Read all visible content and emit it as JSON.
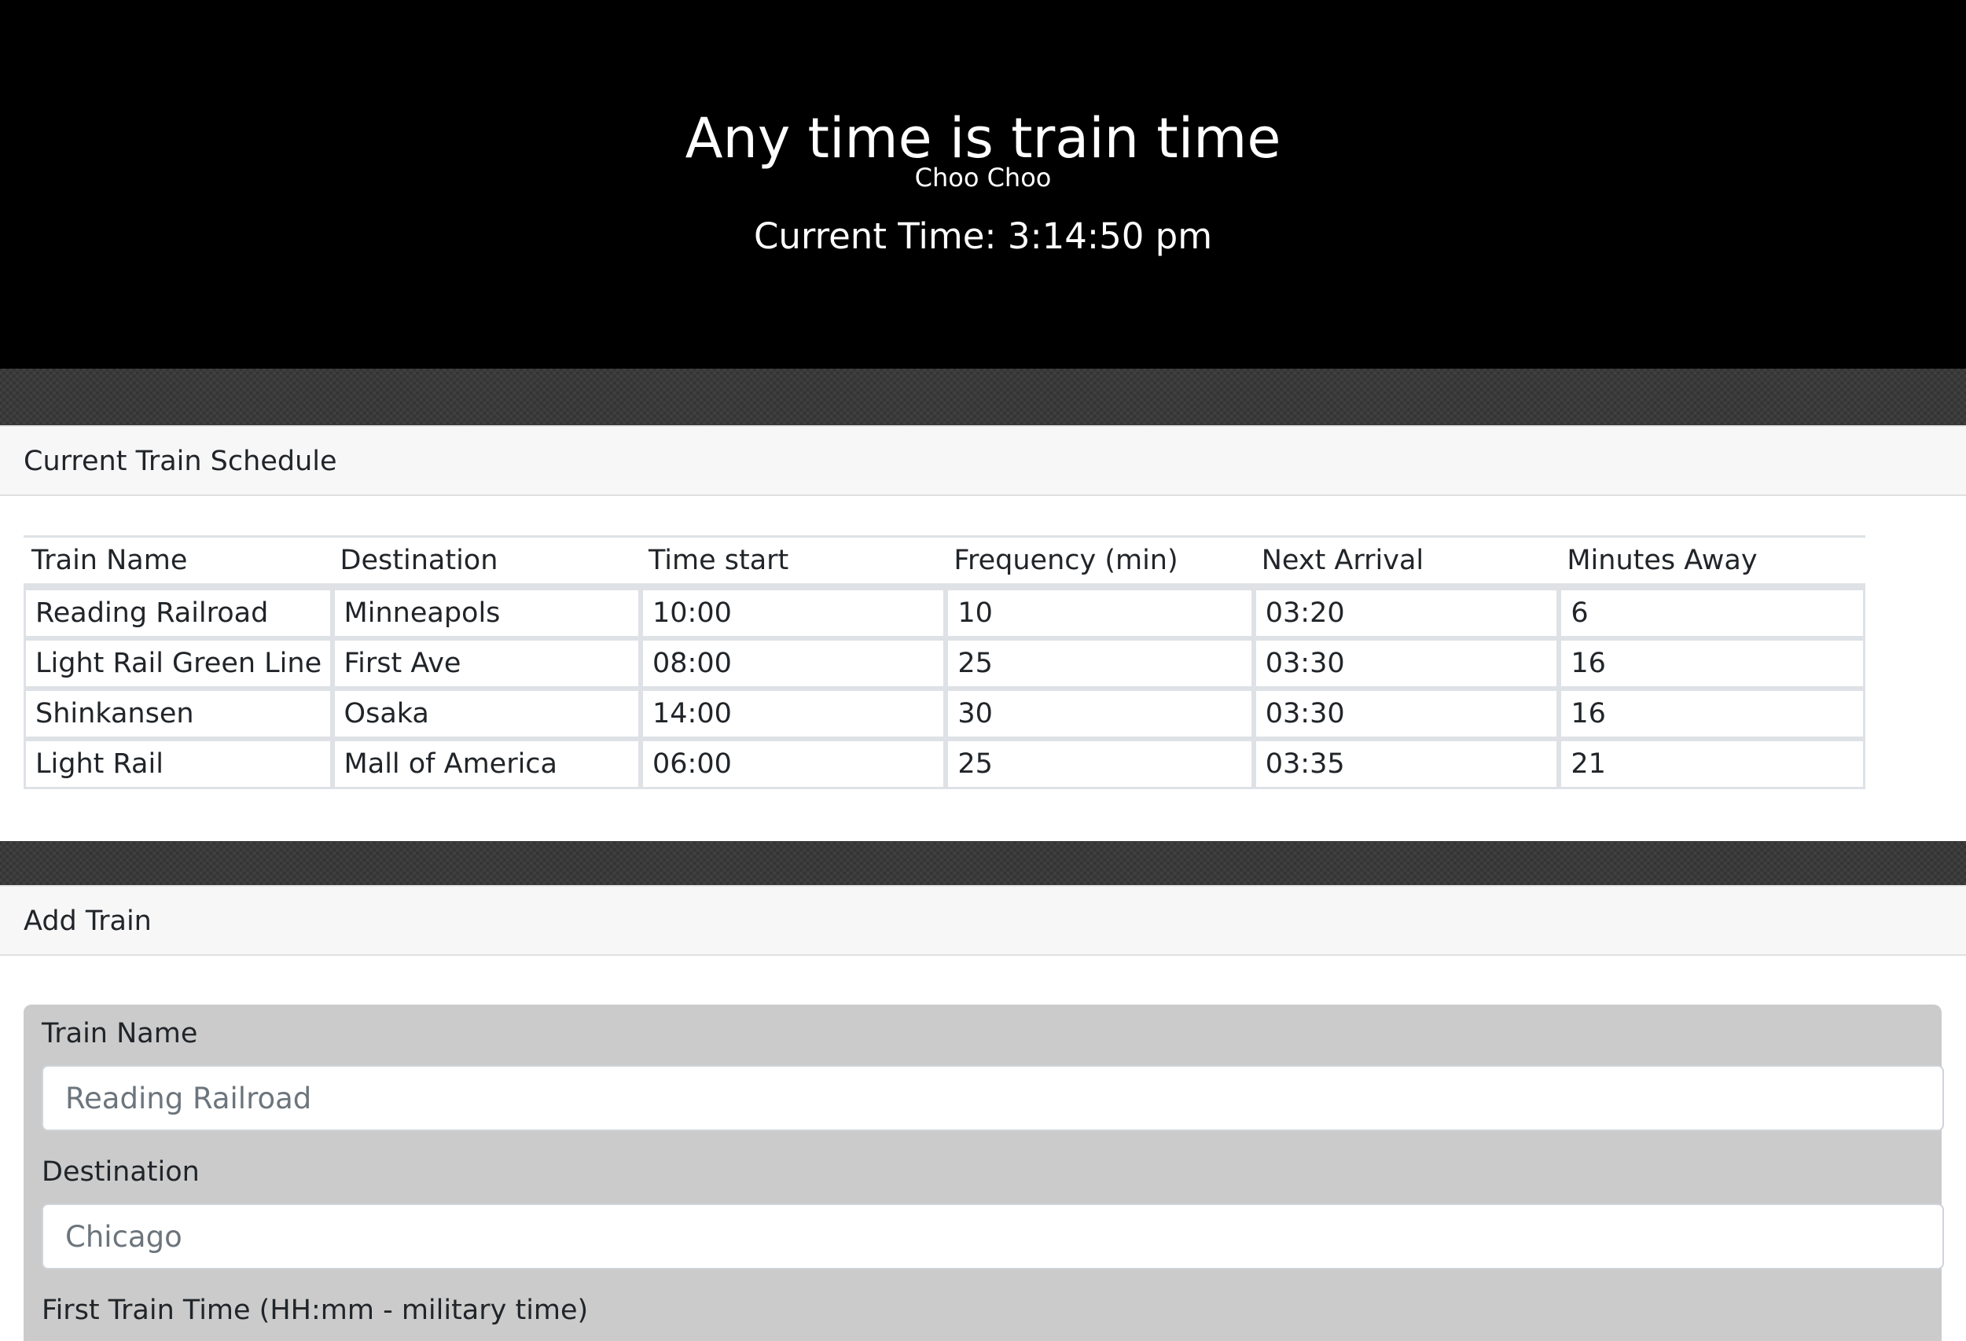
{
  "header": {
    "title": "Any time is train time",
    "subtitle": "Choo Choo",
    "current_time_label": "Current Time: 3:14:50 pm"
  },
  "schedule": {
    "heading": "Current Train Schedule",
    "columns": [
      "Train Name",
      "Destination",
      "Time start",
      "Frequency (min)",
      "Next Arrival",
      "Minutes Away"
    ],
    "rows": [
      [
        "Reading Railroad",
        "Minneapols",
        "10:00",
        "10",
        "03:20",
        "6"
      ],
      [
        "Light Rail Green Line",
        "First Ave",
        "08:00",
        "25",
        "03:30",
        "16"
      ],
      [
        "Shinkansen",
        "Osaka",
        "14:00",
        "30",
        "03:30",
        "16"
      ],
      [
        "Light Rail",
        "Mall of America",
        "06:00",
        "25",
        "03:35",
        "21"
      ]
    ]
  },
  "add_train": {
    "heading": "Add Train",
    "train_name_label": "Train Name",
    "train_name_placeholder": "Reading Railroad",
    "destination_label": "Destination",
    "destination_placeholder": "Chicago",
    "first_time_label": "First Train Time (HH:mm - military time)"
  }
}
